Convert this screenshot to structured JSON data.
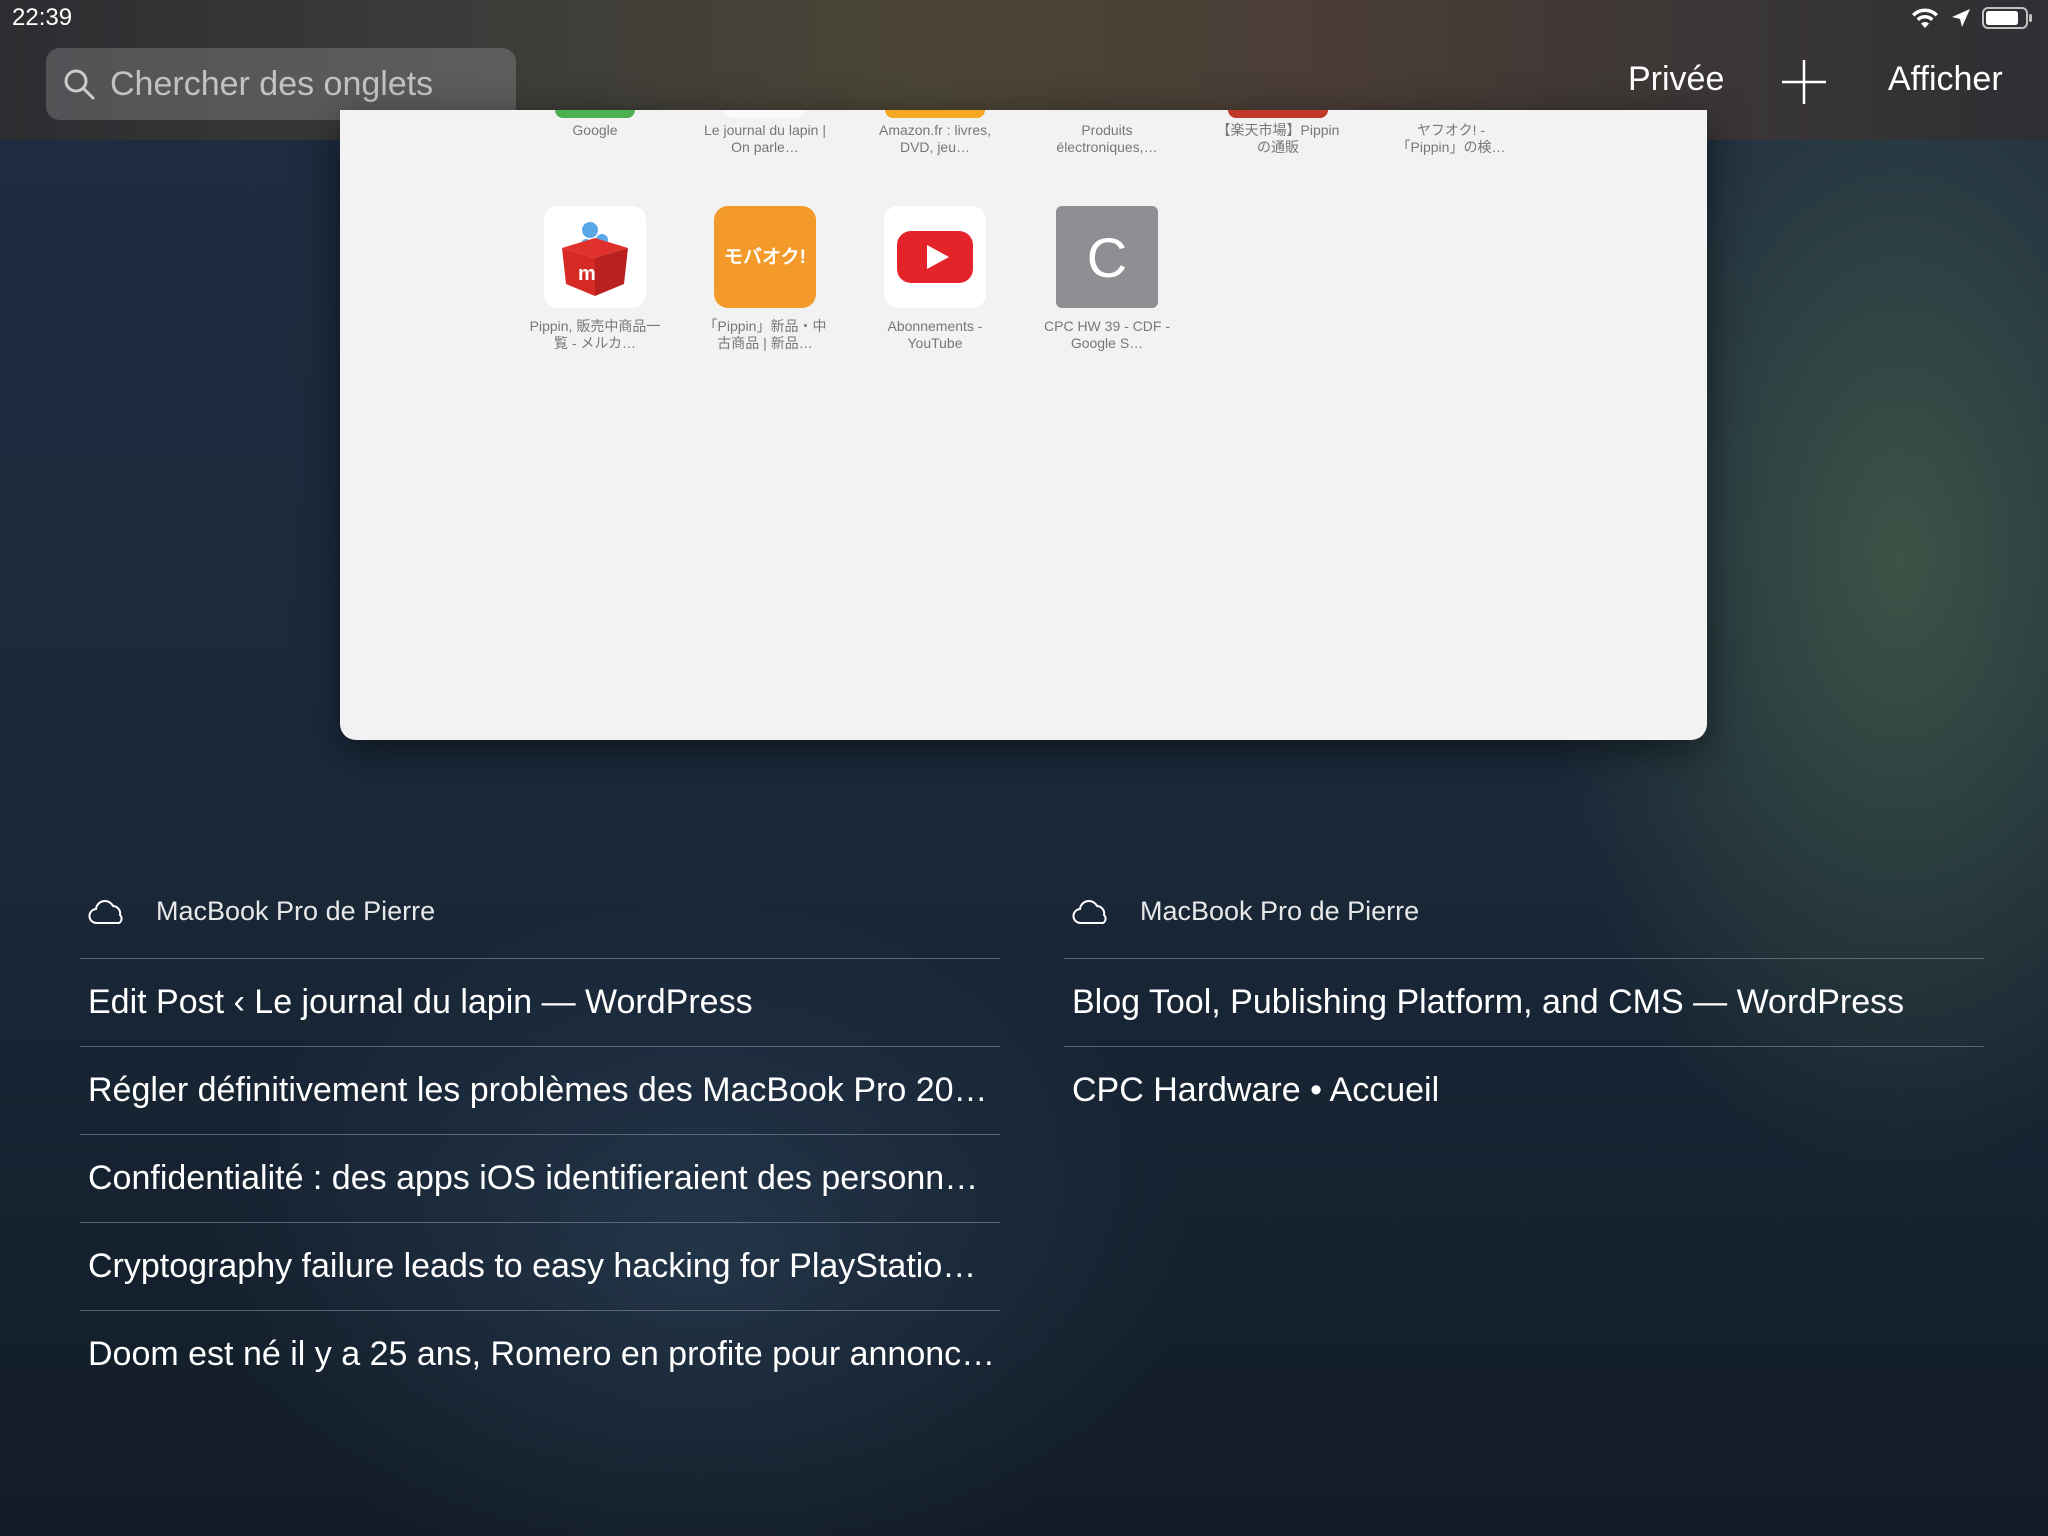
{
  "status": {
    "time": "22:39"
  },
  "search": {
    "placeholder": "Chercher des onglets"
  },
  "toolbar": {
    "private_label": "Privée",
    "show_label": "Afficher"
  },
  "favorites_row1": [
    {
      "label": "Google",
      "stub_color": "#4caf50"
    },
    {
      "label": "Le journal du lapin | On parle…",
      "stub_color": "#f5f5f5"
    },
    {
      "label": "Amazon.fr : livres, DVD, jeu…",
      "stub_color": "#f5a623"
    },
    {
      "label": "Produits électroniques,…",
      "stub_color": "#f2f2f2"
    },
    {
      "label": "【楽天市場】Pippinの通販",
      "stub_color": "#c0392b"
    },
    {
      "label": "ヤフオク! - 「Pippin」の検…",
      "stub_color": "#f2f2f2"
    }
  ],
  "favorites_row2": [
    {
      "label": "Pippin, 販売中商品一覧 - メルカ…",
      "icon": "mercari-box-icon"
    },
    {
      "label": "「Pippin」新品・中古商品 | 新品…",
      "icon": "mobaoku-icon",
      "tile_text": "モバオク!"
    },
    {
      "label": "Abonnements - YouTube",
      "icon": "youtube-icon"
    },
    {
      "label": "CPC HW 39 - CDF - Google S…",
      "icon": "letter-c-icon",
      "tile_text": "C"
    }
  ],
  "cloud_devices": [
    {
      "name": "MacBook Pro de Pierre",
      "tabs": [
        "Edit Post ‹ Le journal du lapin — WordPress",
        "Régler définitivement les problèmes des MacBook Pro 20…",
        "Confidentialité : des apps iOS identifieraient des personn…",
        "Cryptography failure leads to easy hacking for PlayStatio…",
        "Doom est né il y a 25 ans, Romero en profite pour annonc…"
      ]
    },
    {
      "name": "MacBook Pro de Pierre",
      "tabs": [
        "Blog Tool, Publishing Platform, and CMS — WordPress",
        "CPC Hardware • Accueil"
      ]
    }
  ]
}
